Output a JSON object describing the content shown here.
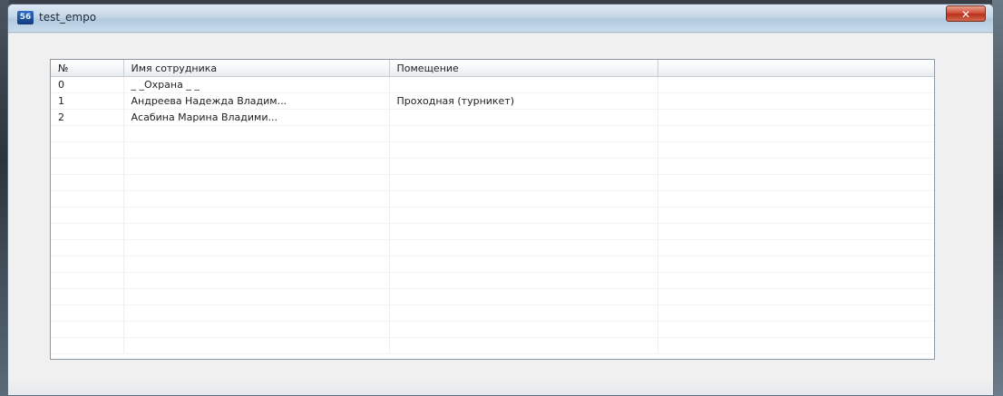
{
  "window": {
    "title": "test_empo",
    "app_icon": "app-icon",
    "app_icon_text": "56",
    "close_glyph": "✕"
  },
  "table": {
    "columns": [
      "№",
      "Имя сотрудника",
      "Помещение",
      ""
    ],
    "rows": [
      [
        "0",
        "_ _Охрана _ _",
        "",
        ""
      ],
      [
        "1",
        "Андреева Надежда Владим...",
        "Проходная (турникет)",
        ""
      ],
      [
        "2",
        "Асабина Марина Владими...",
        "",
        ""
      ],
      [
        "",
        "",
        "",
        ""
      ],
      [
        "",
        "",
        "",
        ""
      ],
      [
        "",
        "",
        "",
        ""
      ],
      [
        "",
        "",
        "",
        ""
      ],
      [
        "",
        "",
        "",
        ""
      ],
      [
        "",
        "",
        "",
        ""
      ],
      [
        "",
        "",
        "",
        ""
      ],
      [
        "",
        "",
        "",
        ""
      ],
      [
        "",
        "",
        "",
        ""
      ],
      [
        "",
        "",
        "",
        ""
      ],
      [
        "",
        "",
        "",
        ""
      ],
      [
        "",
        "",
        "",
        ""
      ],
      [
        "",
        "",
        "",
        ""
      ],
      [
        "",
        "",
        "",
        ""
      ]
    ]
  }
}
